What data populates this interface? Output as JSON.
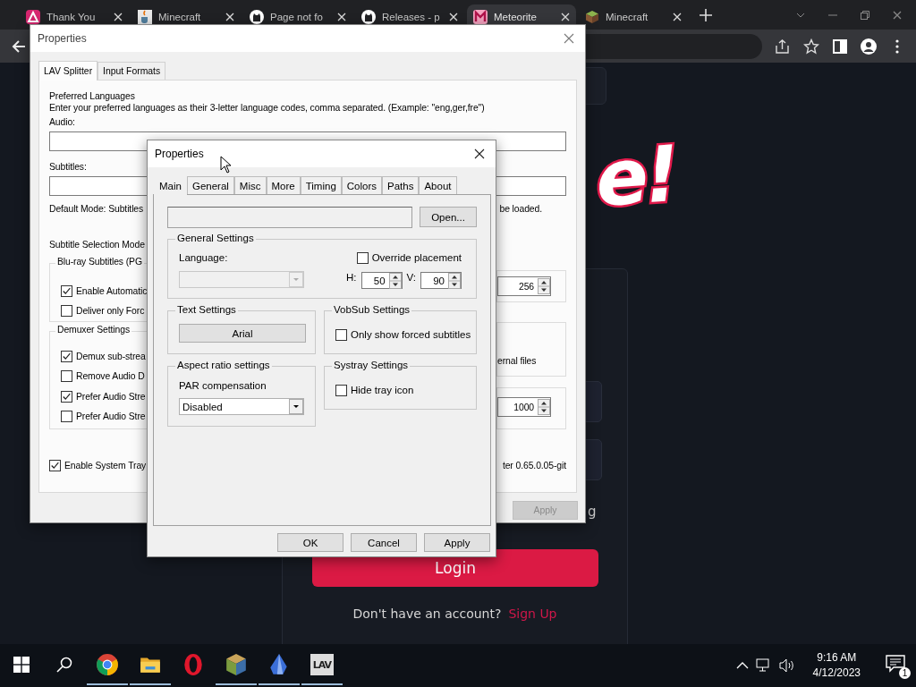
{
  "browser": {
    "tabs": [
      {
        "title": "Thank You",
        "kind": "arc",
        "selected": false
      },
      {
        "title": "Minecraft",
        "kind": "java",
        "selected": false
      },
      {
        "title": "Page not fo",
        "kind": "github",
        "selected": false
      },
      {
        "title": "Releases - p",
        "kind": "github",
        "selected": false
      },
      {
        "title": "Meteorite",
        "kind": "meteorite",
        "selected": true
      },
      {
        "title": "Minecraft",
        "kind": "minecraft",
        "selected": false
      }
    ]
  },
  "webpage": {
    "logo_text": "e!",
    "partial_text": "g",
    "login_button": "Login",
    "signup_prompt": "Don't have an account?",
    "signup_link": "Sign Up"
  },
  "lav_dialog": {
    "title": "Properties",
    "tabs": [
      {
        "label": "LAV Splitter",
        "selected": true
      },
      {
        "label": "Input Formats",
        "selected": false
      }
    ],
    "preferred_heading": "Preferred Languages",
    "preferred_hint": "Enter your preferred languages as their 3-letter language codes, comma separated. (Example: \"eng,ger,fre\")",
    "audio_label": "Audio:",
    "subtitles_label": "Subtitles:",
    "default_mode": "Default Mode: Subtitles",
    "default_mode_tail": "be loaded.",
    "selection_mode_label": "Subtitle Selection Mode",
    "bluray_group": {
      "title": "Blu-ray Subtitles (PG",
      "checks": [
        {
          "label": "Enable Automatic",
          "checked": true
        },
        {
          "label": "Deliver only Forc",
          "checked": false
        }
      ]
    },
    "spinner_1": "256",
    "external_tail": "ernal files",
    "demuxer_group": {
      "title": "Demuxer Settings",
      "checks": [
        {
          "label": "Demux sub-strea",
          "checked": true
        },
        {
          "label": "Remove Audio D",
          "checked": false
        },
        {
          "label": "Prefer Audio Stre",
          "checked": true
        },
        {
          "label": "Prefer Audio Stre",
          "checked": false
        }
      ]
    },
    "spinner_2": "1000",
    "tray": {
      "label": "Enable System Tray",
      "checked": true
    },
    "version_tail": "ter 0.65.0.05-git",
    "apply_button": {
      "label": "Apply",
      "disabled": true
    }
  },
  "props_dialog": {
    "title": "Properties",
    "tabs": [
      {
        "label": "Main",
        "selected": true
      },
      {
        "label": "General",
        "selected": false
      },
      {
        "label": "Misc",
        "selected": false
      },
      {
        "label": "More",
        "selected": false
      },
      {
        "label": "Timing",
        "selected": false
      },
      {
        "label": "Colors",
        "selected": false
      },
      {
        "label": "Paths",
        "selected": false
      },
      {
        "label": "About",
        "selected": false
      }
    ],
    "open_button": "Open...",
    "general": {
      "title": "General Settings",
      "language_label": "Language:",
      "language_disabled": true,
      "override": {
        "label": "Override placement",
        "checked": false
      },
      "h_label": "H:",
      "h_value": "50",
      "v_label": "V:",
      "v_value": "90"
    },
    "text_settings": {
      "title": "Text Settings",
      "font_button": "Arial"
    },
    "vobsub": {
      "title": "VobSub Settings",
      "check": {
        "label": "Only show forced subtitles",
        "checked": false
      }
    },
    "aspect": {
      "title": "Aspect ratio settings",
      "label": "PAR compensation",
      "value": "Disabled"
    },
    "systray": {
      "title": "Systray Settings",
      "check": {
        "label": "Hide tray icon",
        "checked": false
      }
    },
    "buttons": [
      "OK",
      "Cancel",
      "Apply"
    ]
  },
  "taskbar": {
    "apps": [
      {
        "kind": "chrome",
        "running": true
      },
      {
        "kind": "folder",
        "running": true
      },
      {
        "kind": "opera",
        "running": false
      },
      {
        "kind": "minecraft",
        "running": true
      },
      {
        "kind": "crystal",
        "running": true
      },
      {
        "kind": "lav",
        "label": "LAV",
        "running": true
      }
    ],
    "time": "9:16 AM",
    "date": "4/12/2023",
    "notifications": "1"
  }
}
